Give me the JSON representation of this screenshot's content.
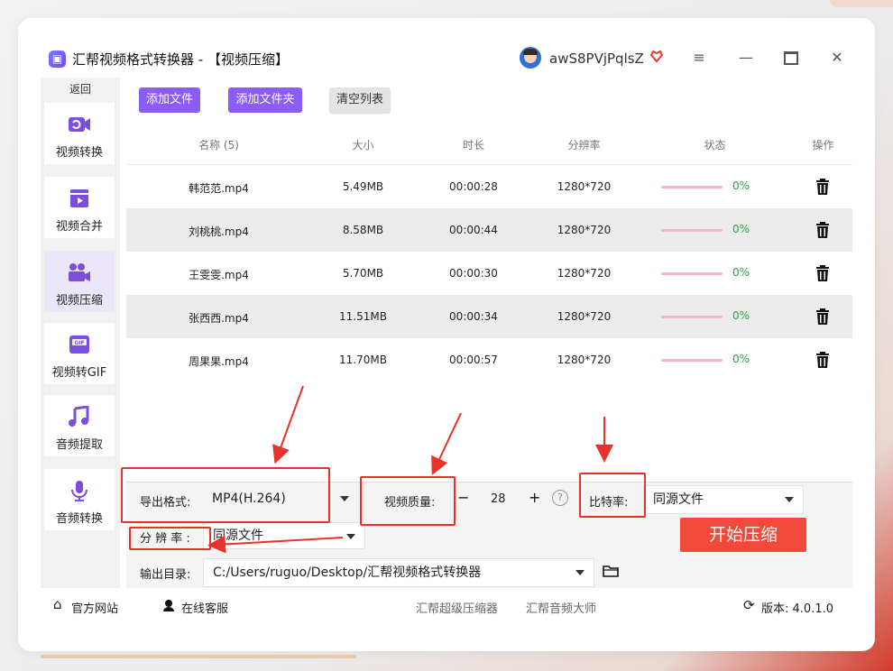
{
  "app": {
    "title": "汇帮视频格式转换器 - 【视频压缩】",
    "user_name": "awS8PVjPqlsZ",
    "menu_glyph": "≡",
    "min_glyph": "—",
    "close_glyph": "✕"
  },
  "sidebar": {
    "back_label": "返回",
    "items": [
      {
        "label": "视频转换",
        "icon": "video-convert-icon"
      },
      {
        "label": "视频合并",
        "icon": "video-merge-icon"
      },
      {
        "label": "视频压缩",
        "icon": "video-compress-icon",
        "active": true
      },
      {
        "label": "视频转GIF",
        "icon": "gif-icon"
      },
      {
        "label": "音频提取",
        "icon": "music-note-icon"
      },
      {
        "label": "音频转换",
        "icon": "microphone-icon"
      }
    ]
  },
  "toolbar": {
    "add_file": "添加文件",
    "add_folder": "添加文件夹",
    "clear_list": "清空列表"
  },
  "table": {
    "headers": {
      "name": "名称 (5)",
      "size": "大小",
      "duration": "时长",
      "resolution": "分辨率",
      "status": "状态",
      "action": "操作"
    },
    "rows": [
      {
        "name": "韩范范.mp4",
        "size": "5.49MB",
        "duration": "00:00:28",
        "resolution": "1280*720",
        "progress": "0%"
      },
      {
        "name": "刘桃桃.mp4",
        "size": "8.58MB",
        "duration": "00:00:44",
        "resolution": "1280*720",
        "progress": "0%"
      },
      {
        "name": "王雯雯.mp4",
        "size": "5.70MB",
        "duration": "00:00:30",
        "resolution": "1280*720",
        "progress": "0%"
      },
      {
        "name": "张西西.mp4",
        "size": "11.51MB",
        "duration": "00:00:34",
        "resolution": "1280*720",
        "progress": "0%"
      },
      {
        "name": "周果果.mp4",
        "size": "11.70MB",
        "duration": "00:00:57",
        "resolution": "1280*720",
        "progress": "0%"
      }
    ]
  },
  "settings": {
    "format_label": "导出格式:",
    "format_value": "MP4(H.264)",
    "quality_label": "视频质量:",
    "quality_minus": "−",
    "quality_value": "28",
    "quality_plus": "+",
    "help_glyph": "?",
    "bitrate_label": "比特率:",
    "bitrate_value": "同源文件",
    "resolution_label": "分 辨 率 :",
    "resolution_value": "同源文件",
    "output_label": "输出目录:",
    "output_value": "C:/Users/ruguo/Desktop/汇帮视频格式转换器",
    "start_button": "开始压缩"
  },
  "footer": {
    "website": "官方网站",
    "service": "在线客服",
    "link1": "汇帮超级压缩器",
    "link2": "汇帮音频大师",
    "version": "版本: 4.0.1.0"
  },
  "colors": {
    "accent": "#8b5cf6",
    "start": "#f2493a",
    "annotation": "#e5322b",
    "progress_text": "#22a33a"
  }
}
